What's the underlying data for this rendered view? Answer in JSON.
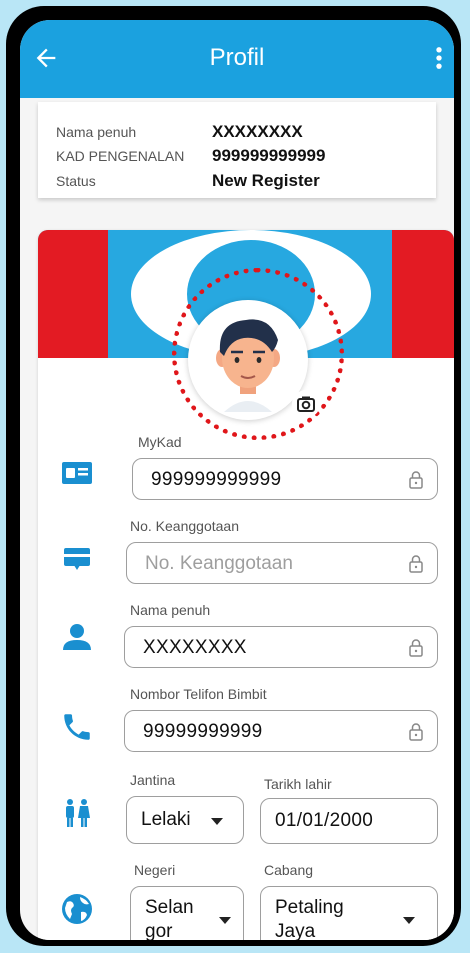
{
  "appbar": {
    "title": "Profil"
  },
  "info": {
    "rows": [
      {
        "label": "Nama penuh",
        "value": "XXXXXXXX"
      },
      {
        "label": "KAD PENGENALAN",
        "value": "999999999999"
      },
      {
        "label": "Status",
        "value": "New Register"
      }
    ]
  },
  "form": {
    "mykad": {
      "label": "MyKad",
      "value": "999999999999"
    },
    "member": {
      "label": "No. Keanggotaan",
      "placeholder": "No. Keanggotaan"
    },
    "name": {
      "label": "Nama penuh",
      "value": "XXXXXXXX"
    },
    "phone": {
      "label": "Nombor Telifon Bimbit",
      "value": "99999999999"
    },
    "gender": {
      "label": "Jantina",
      "value": "Lelaki"
    },
    "dob": {
      "label": "Tarikh lahir",
      "value": "01/01/2000"
    },
    "state": {
      "label": "Negeri",
      "value_line1": "Selan",
      "value_line2": "gor"
    },
    "branch": {
      "label": "Cabang",
      "value_line1": "Petaling",
      "value_line2": "Jaya"
    }
  },
  "colors": {
    "primary": "#1ba1df",
    "flag_red": "#e31b23",
    "flag_blue": "#27a8e0",
    "icon_blue": "#1a8fd0"
  },
  "icons": [
    "arrow-left-icon",
    "more-vert-icon",
    "camera-icon",
    "id-card-icon",
    "membership-card-icon",
    "person-icon",
    "phone-icon",
    "people-icon",
    "globe-icon",
    "lock-icon",
    "caret-down-icon"
  ]
}
